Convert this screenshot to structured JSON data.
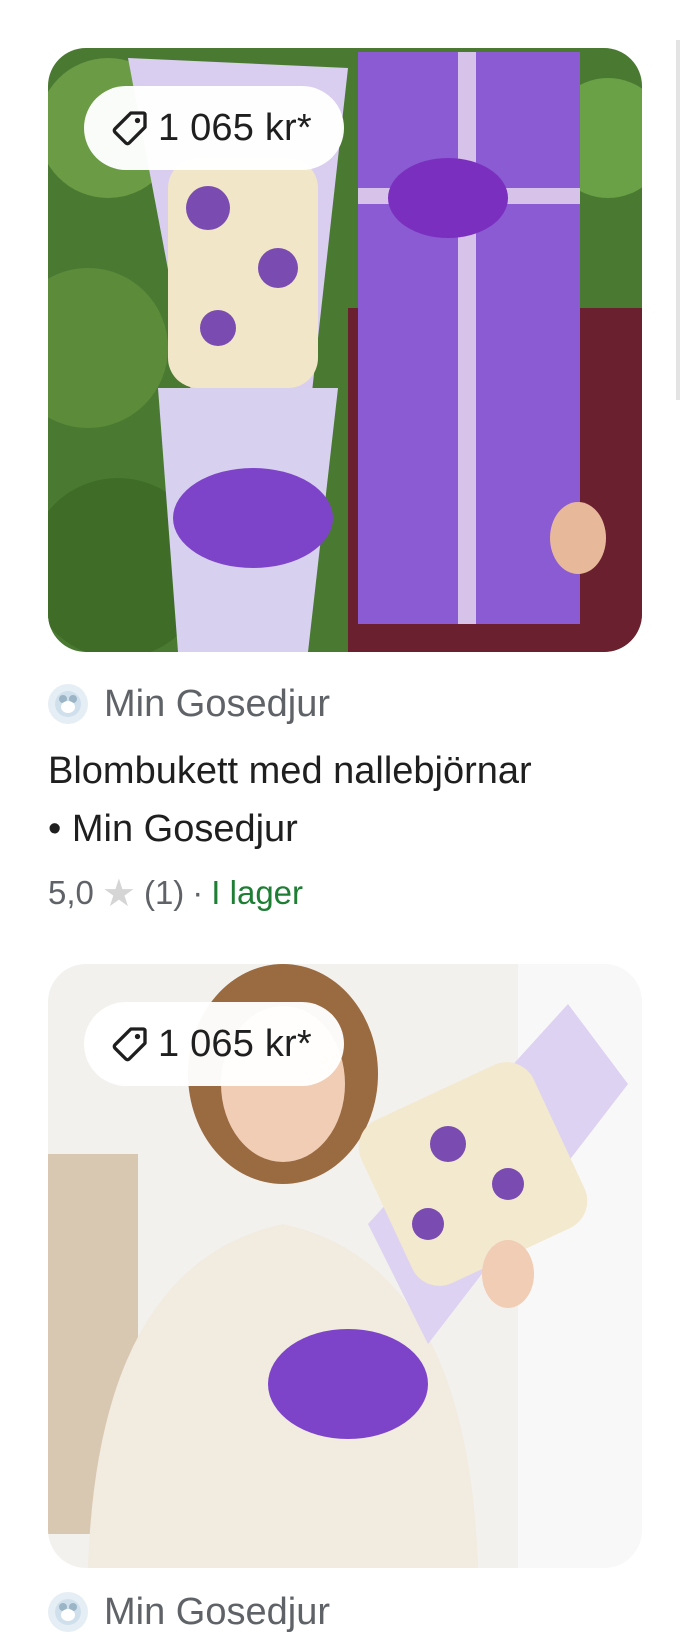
{
  "products": [
    {
      "price": "1 065 kr*",
      "store": "Min Gosedjur",
      "title_line1": "Blombukett med nallebjörnar",
      "title_line2": "• Min Gosedjur",
      "rating": "5,0",
      "reviews": "(1)",
      "separator": "·",
      "stock": "I lager"
    },
    {
      "price": "1 065 kr*",
      "store": "Min Gosedjur"
    }
  ],
  "colors": {
    "accent_purple": "#7b3fc4",
    "stock_green": "#1e7e34",
    "muted_text": "#5f6368"
  },
  "icons": {
    "price_tag": "price-tag-icon",
    "rating_star": "star-icon",
    "store_avatar": "store-avatar-icon"
  }
}
